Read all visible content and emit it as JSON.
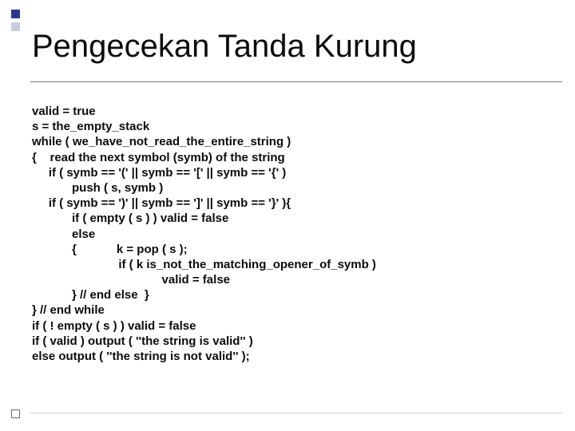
{
  "slide": {
    "title": "Pengecekan Tanda Kurung",
    "code_lines": [
      "valid = true",
      "s = the_empty_stack",
      "while ( we_have_not_read_the_entire_string )",
      "{    read the next symbol (symb) of the string",
      "     if ( symb == '(' || symb == '[' || symb == '{' )",
      "            push ( s, symb )",
      "     if ( symb == ')' || symb == ']' || symb == '}' ){",
      "            if ( empty ( s ) ) valid = false",
      "            else",
      "            {            k = pop ( s );",
      "                          if ( k is_not_the_matching_opener_of_symb )",
      "                                       valid = false",
      "            } // end else  }",
      "} // end while",
      "if ( ! empty ( s ) ) valid = false",
      "if ( valid ) output ( ''the string is valid'' )",
      "else output ( ''the string is not valid'' );"
    ]
  }
}
